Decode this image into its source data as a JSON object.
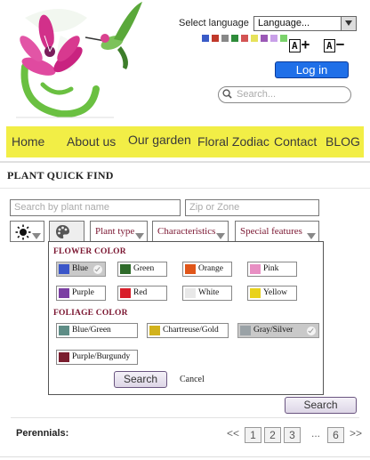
{
  "header": {
    "select_language_label": "Select language",
    "language_dropdown_value": "Language...",
    "flag_colors": [
      "#3a5bc7",
      "#c0392b",
      "#888888",
      "#2e8b3a",
      "#d35454",
      "#e6e25a",
      "#9b59b6",
      "#c9a0e8",
      "#7bd36b"
    ],
    "font_increase_label": "A",
    "font_decrease_label": "A",
    "login_label": "Log in",
    "search_placeholder": "Search..."
  },
  "nav": {
    "items": [
      "Home",
      "About us",
      "Our garden",
      "Floral Zodiac",
      "Contact",
      "BLOG"
    ]
  },
  "quick_find": {
    "title": "PLANT QUICK FIND",
    "plant_name_placeholder": "Search by plant name",
    "zip_placeholder": "Zip or Zone",
    "filters": [
      "Plant type",
      "Characteristics",
      "Special features"
    ],
    "flower_color_heading": "FLOWER COLOR",
    "flower_colors": [
      {
        "label": "Blue",
        "selected": true,
        "color": "#3a56c9"
      },
      {
        "label": "Green",
        "selected": false,
        "color": "#2f6b2a"
      },
      {
        "label": "Orange",
        "selected": false,
        "color": "#e0561a"
      },
      {
        "label": "Pink",
        "selected": false,
        "color": "#e88fc3"
      },
      {
        "label": "Purple",
        "selected": false,
        "color": "#7b3fa3"
      },
      {
        "label": "Red",
        "selected": false,
        "color": "#d81e2a"
      },
      {
        "label": "White",
        "selected": false,
        "color": "#e8e8e8"
      },
      {
        "label": "Yellow",
        "selected": false,
        "color": "#e9d21b"
      }
    ],
    "foliage_color_heading": "FOLIAGE COLOR",
    "foliage_colors": [
      {
        "label": "Blue/Green",
        "selected": false,
        "color": "#5e8d86"
      },
      {
        "label": "Chartreuse/Gold",
        "selected": false,
        "color": "#d2b21c"
      },
      {
        "label": "Gray/Silver",
        "selected": true,
        "color": "#9aa2a6"
      },
      {
        "label": "Purple/Burgundy",
        "selected": false,
        "color": "#7a1d2e"
      }
    ],
    "dropdown_search_label": "Search",
    "cancel_label": "Cancel",
    "search_label": "Search"
  },
  "results": {
    "category_label": "Perennials:",
    "prev_label": "<<",
    "pages": [
      "1",
      "2",
      "3"
    ],
    "ellipsis": "...",
    "last_page": "6",
    "next_label": ">>"
  }
}
